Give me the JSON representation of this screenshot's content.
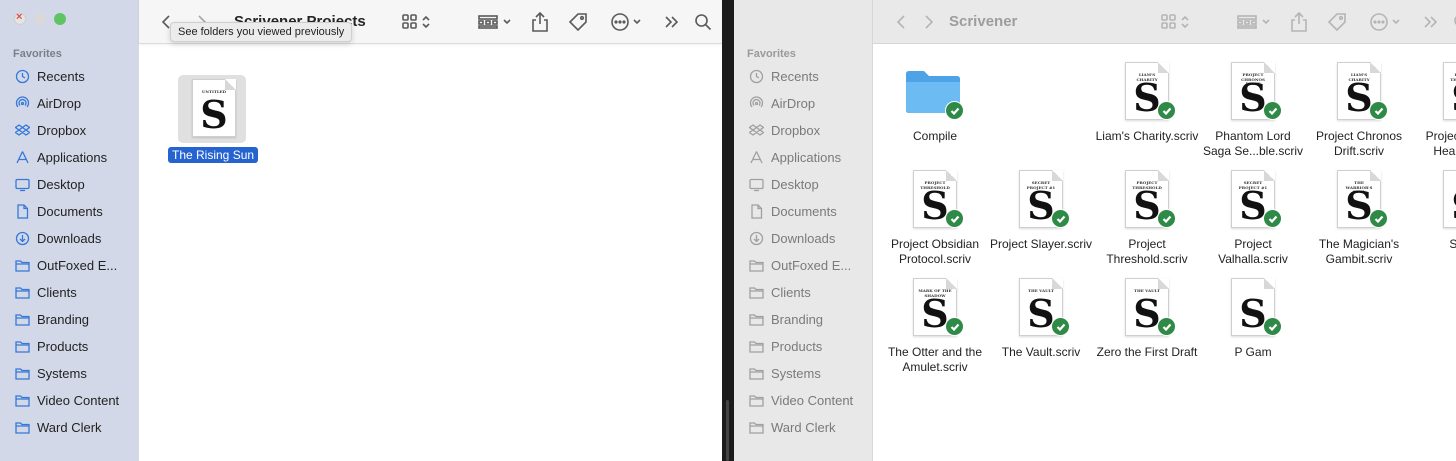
{
  "left_window": {
    "title": "Scrivener Projects",
    "tooltip": "See folders you viewed previously",
    "sidebar_header": "Favorites",
    "sidebar_items": [
      {
        "label": "Recents",
        "icon": "clock-icon"
      },
      {
        "label": "AirDrop",
        "icon": "airdrop-icon"
      },
      {
        "label": "Dropbox",
        "icon": "dropbox-icon"
      },
      {
        "label": "Applications",
        "icon": "applications-icon"
      },
      {
        "label": "Desktop",
        "icon": "desktop-icon"
      },
      {
        "label": "Documents",
        "icon": "document-icon"
      },
      {
        "label": "Downloads",
        "icon": "download-icon"
      },
      {
        "label": "OutFoxed E...",
        "icon": "folder-icon"
      },
      {
        "label": "Clients",
        "icon": "folder-icon"
      },
      {
        "label": "Branding",
        "icon": "folder-icon"
      },
      {
        "label": "Products",
        "icon": "folder-icon"
      },
      {
        "label": "Systems",
        "icon": "folder-icon"
      },
      {
        "label": "Video Content",
        "icon": "folder-icon"
      },
      {
        "label": "Ward Clerk",
        "icon": "folder-icon"
      }
    ],
    "files": [
      {
        "label": "The Rising Sun",
        "doc_title": "UNTITLED"
      }
    ]
  },
  "right_window": {
    "title": "Scrivener",
    "sidebar_header": "Favorites",
    "sidebar_items": [
      {
        "label": "Recents",
        "icon": "clock-icon"
      },
      {
        "label": "AirDrop",
        "icon": "airdrop-icon"
      },
      {
        "label": "Dropbox",
        "icon": "dropbox-icon"
      },
      {
        "label": "Applications",
        "icon": "applications-icon"
      },
      {
        "label": "Desktop",
        "icon": "desktop-icon"
      },
      {
        "label": "Documents",
        "icon": "document-icon"
      },
      {
        "label": "Downloads",
        "icon": "download-icon"
      },
      {
        "label": "OutFoxed E...",
        "icon": "folder-icon"
      },
      {
        "label": "Clients",
        "icon": "folder-icon"
      },
      {
        "label": "Branding",
        "icon": "folder-icon"
      },
      {
        "label": "Products",
        "icon": "folder-icon"
      },
      {
        "label": "Systems",
        "icon": "folder-icon"
      },
      {
        "label": "Video Content",
        "icon": "folder-icon"
      },
      {
        "label": "Ward Clerk",
        "icon": "folder-icon"
      }
    ],
    "files": [
      {
        "label": "Compile",
        "kind": "folder",
        "synced": true
      },
      {
        "label": "Liam's Charity.scriv",
        "kind": "scriv",
        "doc_title": "LIAM'S CHARITY",
        "synced": true
      },
      {
        "label": "Phantom Lord Saga Se...ble.scriv",
        "kind": "scriv",
        "doc_title": "PROJECT CHRONOS DRIFT",
        "synced": true
      },
      {
        "label": "Project Chronos Drift.scriv",
        "kind": "scriv",
        "doc_title": "LIAM'S CHARITY",
        "synced": true
      },
      {
        "label": "Project Mosaic Hearts.scriv",
        "kind": "scriv",
        "doc_title": "PROJECT THRESHOLD",
        "synced": true
      },
      {
        "label": "Project Obsidian Protocol.scriv",
        "kind": "scriv",
        "doc_title": "PROJECT THRESHOLD",
        "synced": true
      },
      {
        "label": "Project Slayer.scriv",
        "kind": "scriv",
        "doc_title": "SECRET PROJECT #1",
        "synced": true
      },
      {
        "label": "Project Threshold.scriv",
        "kind": "scriv",
        "doc_title": "PROJECT THRESHOLD",
        "synced": true
      },
      {
        "label": "Project Valhalla.scriv",
        "kind": "scriv",
        "doc_title": "SECRET PROJECT #1",
        "synced": true
      },
      {
        "label": "The Magician's Gambit.scriv",
        "kind": "scriv",
        "doc_title": "THE WARRIOR'S SOUL",
        "synced": true
      },
      {
        "label": "The Otter and the Amulet.scriv",
        "kind": "scriv",
        "doc_title": "MARK OF THE SHADOW",
        "synced": true
      },
      {
        "label": "The Vault.scriv",
        "kind": "scriv",
        "doc_title": "THE VAULT",
        "synced": true
      },
      {
        "label": "Zero the First Draft",
        "kind": "scriv",
        "doc_title": "THE VAULT",
        "synced": true
      },
      {
        "label": "P Gam",
        "kind": "scriv",
        "doc_title": "",
        "synced": true
      },
      {
        "label": "Shadt",
        "kind": "scriv",
        "doc_title": "",
        "synced": true
      }
    ]
  },
  "colors": {
    "accent": "#3478d8",
    "selection": "#2563d0",
    "sync_check": "#2f8a47",
    "folder": "#5aaee8"
  }
}
